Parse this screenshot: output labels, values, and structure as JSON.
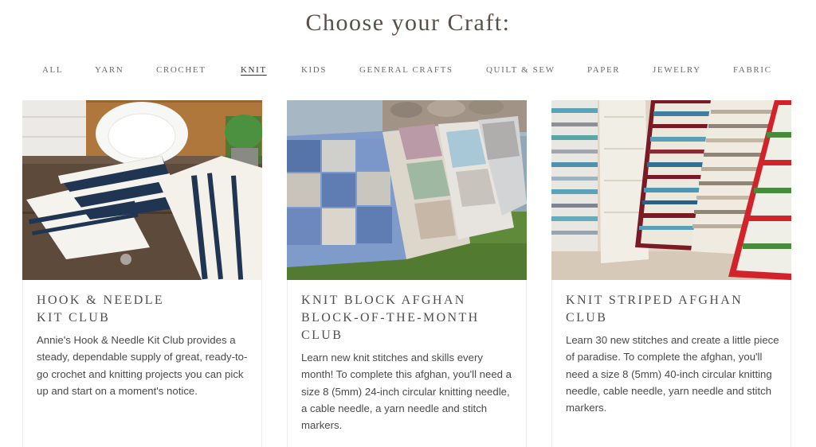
{
  "heading": "Choose your Craft:",
  "filters": [
    {
      "label": "ALL"
    },
    {
      "label": "YARN"
    },
    {
      "label": "CROCHET"
    },
    {
      "label": "KNIT",
      "active": true
    },
    {
      "label": "KIDS"
    },
    {
      "label": "GENERAL CRAFTS"
    },
    {
      "label": "QUILT & SEW"
    },
    {
      "label": "PAPER"
    },
    {
      "label": "JEWELRY"
    },
    {
      "label": "FABRIC"
    }
  ],
  "cards": [
    {
      "title_line1": "HOOK & NEEDLE",
      "title_line2": "KIT CLUB",
      "title_line3": "",
      "description": "Annie's Hook & Needle Kit Club provides a steady, dependable supply of great, ready-to-go crochet and knitting projects you can pick up and start on a moment's notice."
    },
    {
      "title_line1": "KNIT BLOCK AFGHAN",
      "title_line2": "BLOCK-OF-THE-MONTH",
      "title_line3": "CLUB",
      "description": "Learn new knit stitches and skills every month! To complete this afghan, you'll need a size 8 (5mm) 24-inch circular knitting needle, a cable needle, a yarn needle and stitch markers."
    },
    {
      "title_line1": "KNIT STRIPED AFGHAN",
      "title_line2": "CLUB",
      "title_line3": "",
      "description": "Learn 30 new stitches and create a little piece of paradise. To complete the afghan, you'll need a size 8 (5mm) 40-inch circular knitting needle, cable needle, yarn needle and stitch markers."
    }
  ]
}
